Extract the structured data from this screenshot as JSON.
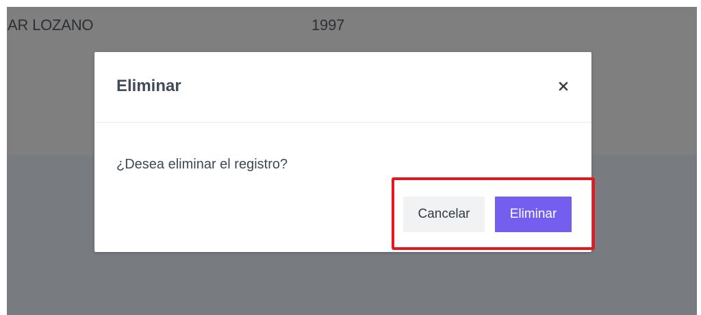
{
  "background_table": {
    "row": {
      "name": "AR LOZANO",
      "year": "1997"
    }
  },
  "modal": {
    "title": "Eliminar",
    "close_icon": "close-icon",
    "message": "¿Desea eliminar el registro?",
    "cancel_label": "Cancelar",
    "confirm_label": "Eliminar"
  },
  "colors": {
    "backdrop_top": "#7f7f7f",
    "backdrop_bottom": "#787c80",
    "title_text": "#3f4a5a",
    "cancel_bg": "#f1f2f4",
    "confirm_bg": "#735ef0",
    "highlight_border": "#e8151b"
  }
}
